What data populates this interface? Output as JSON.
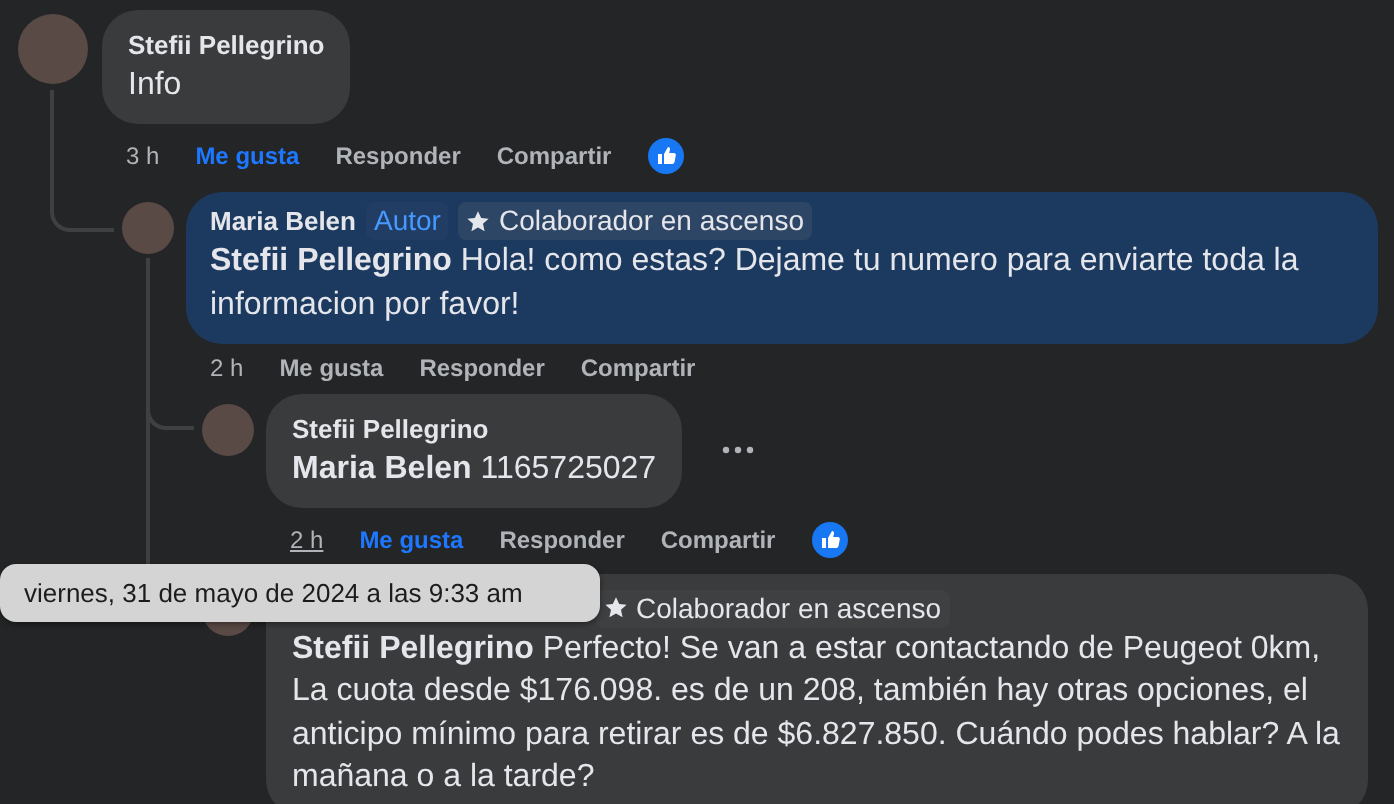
{
  "comments": [
    {
      "author": "Stefii Pellegrino",
      "text": "Info",
      "time": "3 h",
      "time_hovered": false,
      "like_label": "Me gusta",
      "liked": true,
      "reply_label": "Responder",
      "share_label": "Compartir",
      "has_reactions": true,
      "more_menu": false,
      "highlighted": false,
      "children": [
        {
          "author": "Maria Belen",
          "badges": [
            {
              "kind": "author",
              "label": "Autor"
            },
            {
              "kind": "contributor",
              "label": "Colaborador en ascenso"
            }
          ],
          "mention": "Stefii Pellegrino",
          "text": "Hola! como estas? Dejame tu numero para enviarte toda la informacion por favor!",
          "time": "2 h",
          "time_hovered": false,
          "like_label": "Me gusta",
          "liked": false,
          "reply_label": "Responder",
          "share_label": "Compartir",
          "has_reactions": false,
          "more_menu": false,
          "highlighted": true,
          "children": [
            {
              "author": "Stefii Pellegrino",
              "mention": "Maria Belen",
              "text": "1165725027",
              "time": "2 h",
              "time_hovered": true,
              "like_label": "Me gusta",
              "liked": true,
              "reply_label": "Responder",
              "share_label": "Compartir",
              "has_reactions": true,
              "more_menu": true,
              "highlighted": false
            },
            {
              "badges": [
                {
                  "kind": "contributor",
                  "label": "Colaborador en ascenso"
                }
              ],
              "mention": "Stefii Pellegrino",
              "text": "Perfecto! Se van a estar contactando de Peugeot 0km, La cuota desde $176.098. es de un 208, también hay otras opciones, el anticipo mínimo para retirar es de $6.827.850. Cuándo podes hablar? A la mañana o a la tarde?",
              "highlighted": false,
              "more_menu": false
            }
          ]
        }
      ]
    }
  ],
  "tooltip": {
    "text": "viernes, 31 de mayo de 2024 a las 9:33 am"
  }
}
